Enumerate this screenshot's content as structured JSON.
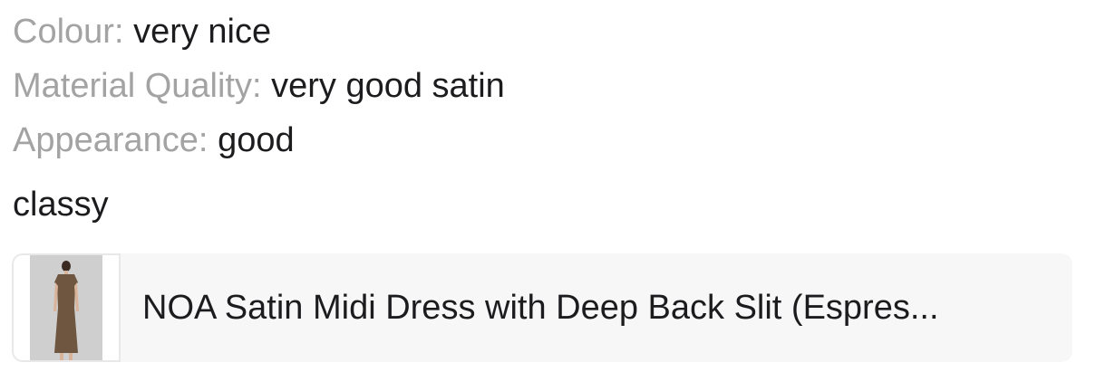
{
  "ratings": [
    {
      "label": "Colour:",
      "value": "very nice"
    },
    {
      "label": "Material Quality:",
      "value": "very good satin"
    },
    {
      "label": "Appearance:",
      "value": "good"
    }
  ],
  "comment": "classy",
  "product": {
    "title": "NOA Satin Midi Dress with Deep Back Slit (Espres..."
  }
}
